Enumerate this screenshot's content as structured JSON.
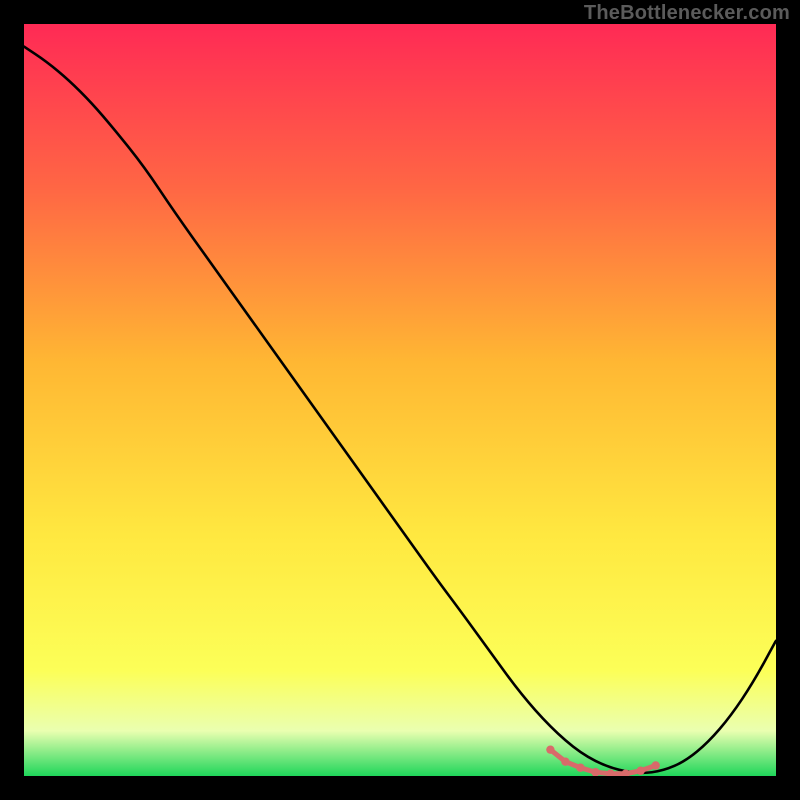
{
  "watermark": "TheBottlenecker.com",
  "colors": {
    "black": "#000000",
    "curve": "#000000",
    "marker": "#d96a6a",
    "grad_top": "#ff2a55",
    "grad_upper": "#ff6a3a",
    "grad_mid": "#ffb733",
    "grad_yellowA": "#ffe840",
    "grad_yellowB": "#fcff58",
    "grad_pale": "#eaffb0",
    "grad_green": "#1fd65a",
    "text_gray": "#5b5b5b"
  },
  "chart_data": {
    "type": "line",
    "title": "",
    "xlabel": "",
    "ylabel": "",
    "xlim": [
      0,
      100
    ],
    "ylim": [
      0,
      100
    ],
    "series": [
      {
        "name": "bottleneck-curve",
        "x": [
          0,
          3,
          6,
          9,
          12,
          16,
          20,
          25,
          30,
          35,
          40,
          45,
          50,
          55,
          58,
          62,
          66,
          70,
          74,
          78,
          82,
          85,
          88,
          91,
          94,
          97,
          100
        ],
        "y": [
          97,
          95,
          92.5,
          89.5,
          86,
          81,
          75,
          68,
          61,
          54,
          47,
          40,
          33,
          26,
          22,
          16.5,
          11,
          6.5,
          3,
          1,
          0.3,
          0.7,
          2,
          4.5,
          8,
          12.5,
          18
        ]
      }
    ],
    "markers": {
      "name": "optimal-zone",
      "x": [
        70,
        72,
        74,
        76,
        78,
        80,
        82,
        84
      ],
      "y": [
        3.5,
        1.9,
        1.1,
        0.5,
        0.3,
        0.3,
        0.7,
        1.4
      ]
    }
  }
}
